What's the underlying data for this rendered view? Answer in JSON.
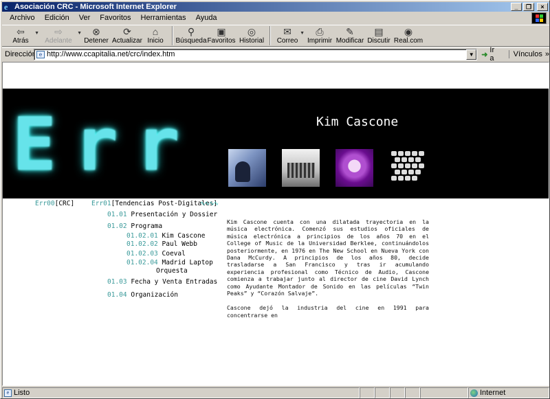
{
  "window": {
    "title": "Asociación CRC - Microsoft Internet Explorer"
  },
  "menu": [
    "Archivo",
    "Edición",
    "Ver",
    "Favoritos",
    "Herramientas",
    "Ayuda"
  ],
  "toolbar": {
    "back": "Atrás",
    "forward": "Adelante",
    "stop": "Detener",
    "refresh": "Actualizar",
    "home": "Inicio",
    "search": "Búsqueda",
    "favorites": "Favoritos",
    "history": "Historial",
    "mail": "Correo",
    "print": "Imprimir",
    "edit": "Modificar",
    "discuss": "Discutir",
    "realcom": "Real.com"
  },
  "address": {
    "label": "Dirección",
    "url": "http://www.ccapitalia.net/crc/index.htm",
    "go": "Ir a",
    "links": "Vínculos"
  },
  "page": {
    "banner_word": "Err",
    "artist_name": "Kim Cascone",
    "nav_root": {
      "code": "Err00",
      "label": "[CRC]"
    },
    "nav_section": {
      "code": "Err01",
      "label": "[Tendencias Post-Digitales]"
    },
    "nav_items": [
      {
        "code": "01.01",
        "label": "Presentación y Dossier"
      },
      {
        "code": "01.02",
        "label": "Programa"
      },
      {
        "code": "01.02.01",
        "label": "Kim Cascone"
      },
      {
        "code": "01.02.02",
        "label": "Paul Webb"
      },
      {
        "code": "01.02.03",
        "label": "Coeval"
      },
      {
        "code": "01.02.04",
        "label": "Madrid Laptop"
      },
      {
        "code": "",
        "label": "Orquesta"
      },
      {
        "code": "01.03",
        "label": "Fecha y Venta Entradas"
      },
      {
        "code": "01.04",
        "label": "Organización"
      }
    ],
    "article": [
      "Kim Cascone cuenta con una dilatada trayectoria en la música electrónica. Comenzó sus estudios oficiales de música electrónica a principios de los años 70 en el College of Music de la Universidad Berklee, continuándolos posteriormente, en 1976 en The New School en Nueva York con Dana McCurdy. A principios de los años 80, decide trasladarse a San Francisco y tras ir acumulando experiencia profesional como Técnico de Audio, Cascone comienza a trabajar junto al director de cine David Lynch como Ayudante Montador de Sonido en las películas “Twin Peaks” y “Corazón Salvaje”.",
      "Cascone dejó la industria del cine en 1991 para concentrarse en"
    ]
  },
  "status": {
    "text": "Listo",
    "zone": "Internet"
  },
  "colors": {
    "banner_glow": "#66e3ea",
    "nav_code": "#3a9a9a",
    "titlebar": "#0a246a"
  }
}
